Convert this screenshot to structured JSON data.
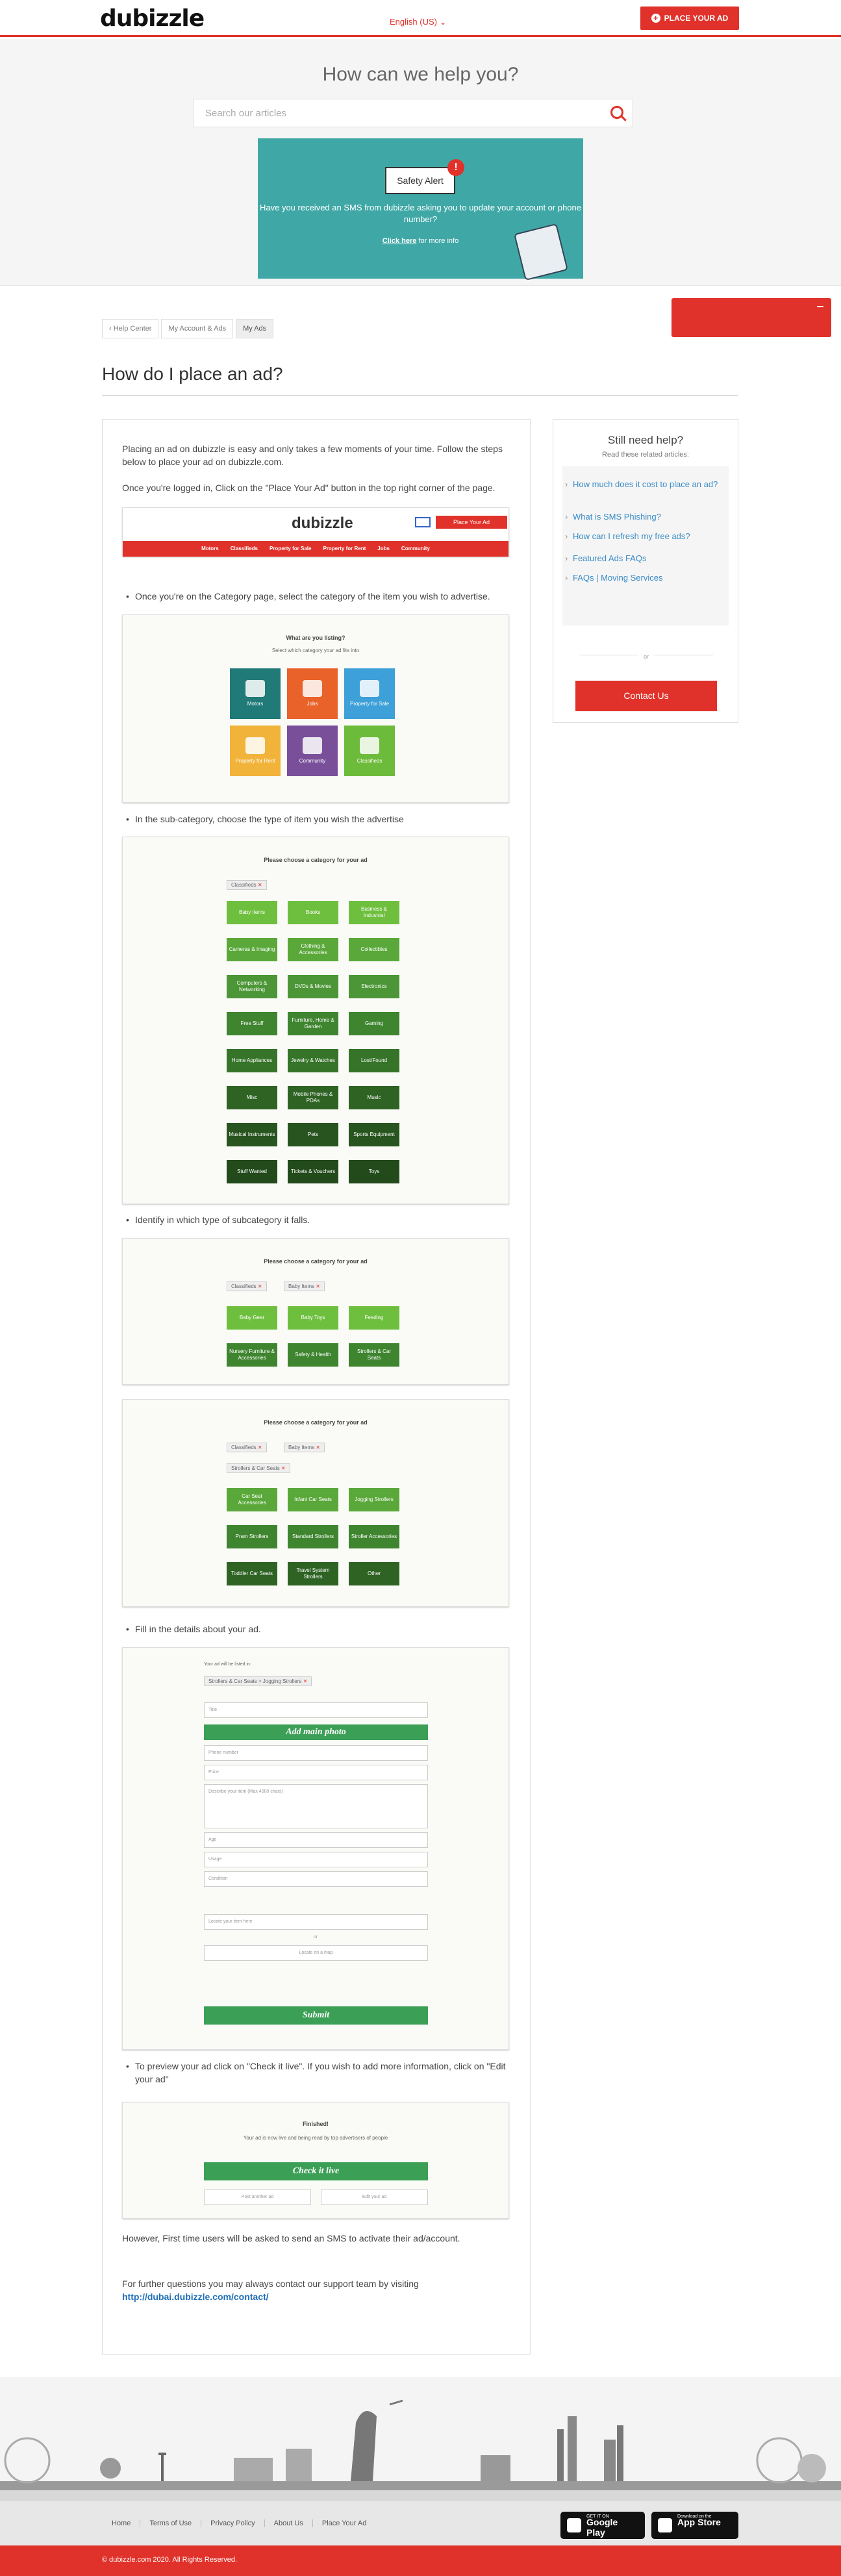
{
  "header": {
    "logo": "dubizzle",
    "language": "English (US)",
    "place_ad": "PLACE YOUR AD"
  },
  "hero": {
    "title": "How can we help you?",
    "search_placeholder": "Search our articles"
  },
  "banner": {
    "bubble": "Safety Alert",
    "text": "Have you received an SMS from dubizzle asking you to update your account or phone number?",
    "click": "Click here",
    "more": " for more info"
  },
  "breadcrumb": [
    "Help Center",
    "My Account & Ads",
    "My Ads"
  ],
  "article": {
    "title": "How do I place an ad?",
    "intro": "Placing an ad on dubizzle is easy and only takes a few moments of your time. Follow the steps below to place your ad on dubizzle.com.",
    "login": "Once you're logged in, Click on the \"Place Your Ad\" button in the top right corner of the page.",
    "step_category": "Once you're on the Category page, select the category of the item you wish to advertise.",
    "step_sub": "In the sub-category, choose the type of item you wish the advertise",
    "step_type": "Identify in which type of subcategory it falls.",
    "step_details": "Fill in the details about your ad.",
    "step_preview": "To preview your ad click on \"Check it live\". If you wish to add more information, click on \"Edit your ad\"",
    "sms": "However, First time users will be asked to send an SMS to activate their ad/account.",
    "contact_text": "For further questions you may always contact our support team by visiting ",
    "contact_link": "http://dubai.dubizzle.com/contact/"
  },
  "shot_nav": {
    "logo": "dubizzle",
    "place": "Place Your Ad",
    "menu": [
      "Motors",
      "Classifieds",
      "Property for Sale",
      "Property for Rent",
      "Jobs",
      "Community"
    ]
  },
  "shot_cat": {
    "caption": "What are you listing?",
    "sub": "Select which category your ad fits into",
    "tiles": [
      {
        "label": "Motors",
        "color": "#1f7a78"
      },
      {
        "label": "Jobs",
        "color": "#e8622a"
      },
      {
        "label": "Property for Sale",
        "color": "#3da0d8"
      },
      {
        "label": "Property for Rent",
        "color": "#f2b33a"
      },
      {
        "label": "Community",
        "color": "#7a4f9a"
      },
      {
        "label": "Classifieds",
        "color": "#6dbb3a"
      }
    ]
  },
  "shot_sub": {
    "caption": "Please choose a category for your ad",
    "chip": "Classifieds",
    "items": [
      "Baby Items",
      "Books",
      "Business & Industrial",
      "Cameras & Imaging",
      "Clothing & Accessories",
      "Collectibles",
      "Computers & Networking",
      "DVDs & Movies",
      "Electronics",
      "Free Stuff",
      "Furniture, Home & Garden",
      "Gaming",
      "Home Appliances",
      "Jewelry & Watches",
      "Lost/Found",
      "Misc",
      "Mobile Phones & PDAs",
      "Music",
      "Musical Instruments",
      "Pets",
      "Sports Equipment",
      "Stuff Wanted",
      "Tickets & Vouchers",
      "Toys"
    ]
  },
  "shot_type1": {
    "caption": "Please choose a category for your ad",
    "chips": [
      "Classifieds",
      "Baby Items"
    ],
    "items": [
      "Baby Gear",
      "Baby Toys",
      "Feeding",
      "Nursery Furniture & Accessories",
      "Safety & Health",
      "Strollers & Car Seats"
    ]
  },
  "shot_type2": {
    "caption": "Please choose a category for your ad",
    "chips": [
      "Classifieds",
      "Baby Items",
      "Strollers & Car Seats"
    ],
    "items": [
      "Car Seat Accessories",
      "Infant Car Seats",
      "Jogging Strollers",
      "Pram Strollers",
      "Standard Strollers",
      "Stroller Accessories",
      "Toddler Car Seats",
      "Travel System Strollers",
      "Other"
    ]
  },
  "shot_form": {
    "listed_in": "Your ad will be listed in:",
    "chip": "Strollers & Car Seats > Jogging Strollers",
    "title": "Title",
    "photo": "Add main photo",
    "phone": "Phone number",
    "price": "Price",
    "desc": "Describe your item (Max 4000 chars)",
    "age": "Age",
    "usage": "Usage",
    "condition": "Condition",
    "locate": "Locate your item here",
    "or": "or",
    "map": "Locate on a map",
    "submit": "Submit"
  },
  "shot_preview": {
    "caption": "Finished!",
    "sub": "Your ad is now live and being read by top advertisers of people",
    "check": "Check it live",
    "post": "Post another ad",
    "edit": "Edit your ad"
  },
  "sidebar": {
    "title": "Still need help?",
    "subtitle": "Read these related articles:",
    "links": [
      "How much does it cost to place an ad?",
      "What is SMS Phishing?",
      "How can I refresh my free ads?",
      "Featured Ads FAQs",
      "FAQs | Moving Services"
    ],
    "or": "or",
    "contact": "Contact Us"
  },
  "footer": {
    "links": [
      "Home",
      "Terms of Use",
      "Privacy Policy",
      "About Us",
      "Place Your Ad"
    ],
    "gp_small": "GET IT ON",
    "gp": "Google Play",
    "as_small": "Download on the",
    "as": "App Store",
    "copyright": "© dubizzle.com 2020. All Rights Reserved."
  }
}
